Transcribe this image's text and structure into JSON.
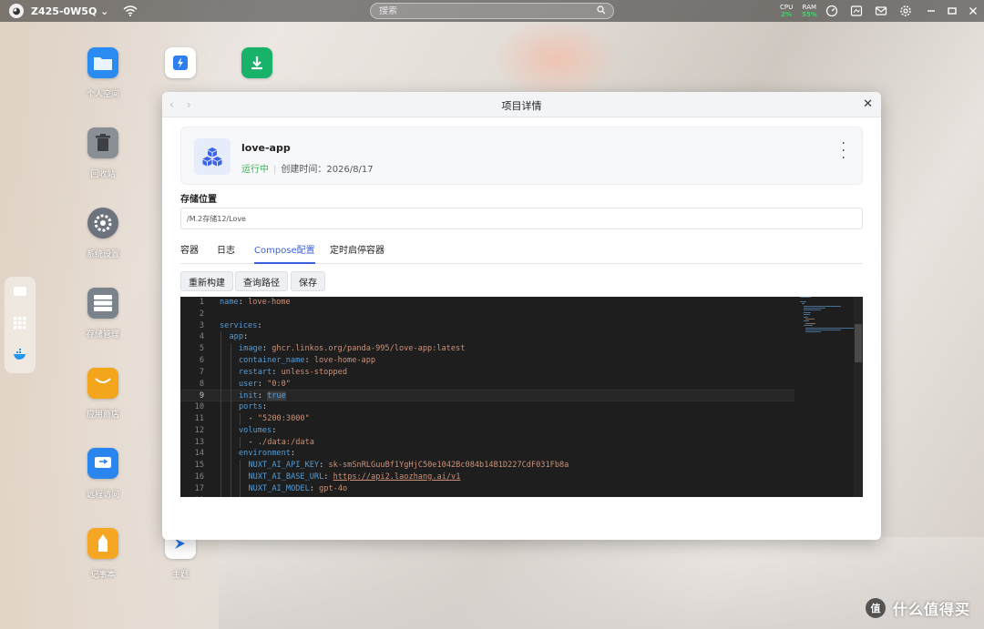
{
  "topbar": {
    "device_name": "Z425-0W5Q",
    "search_placeholder": "搜索",
    "cpu_label": "CPU",
    "cpu_value": "2%",
    "ram_label": "RAM",
    "ram_value": "55%"
  },
  "desktop_icons": [
    {
      "label": "个人空间",
      "icon": "folder-icon",
      "color": "#2a8bf2"
    },
    {
      "label": "回收站",
      "icon": "trash-icon",
      "color": "#8a8f96"
    },
    {
      "label": "系统设置",
      "icon": "gear-icon",
      "color": "#6c737c"
    },
    {
      "label": "存储管理",
      "icon": "storage-icon",
      "color": "#7a828c"
    },
    {
      "label": "应用商店",
      "icon": "store-icon",
      "color": "#f3a51c"
    },
    {
      "label": "远程访问",
      "icon": "remote-icon",
      "color": "#2a86ee"
    },
    {
      "label": "记事本",
      "icon": "notepad-icon",
      "color": "#f5a623"
    },
    {
      "label": "主题",
      "icon": "theme-icon",
      "color": "#1e73e8"
    }
  ],
  "window": {
    "title": "项目详情",
    "project": {
      "name": "love-app",
      "status": "运行中",
      "created_label": "创建时间：",
      "created_date": "2026/8/17"
    },
    "storage": {
      "label": "存储位置",
      "path": "/M.2存储12/Love"
    },
    "tabs": [
      {
        "label": "容器",
        "active": false
      },
      {
        "label": "日志",
        "active": false
      },
      {
        "label": "Compose配置",
        "active": true
      },
      {
        "label": "定时启停容器",
        "active": false
      }
    ],
    "buttons": {
      "rebuild": "重新构建",
      "query_path": "查询路径",
      "save": "保存"
    },
    "editor": {
      "current_line": 9,
      "lines": [
        {
          "n": "1",
          "indent": 0,
          "key": "name",
          "val": "love-home"
        },
        {
          "n": "2",
          "indent": 0
        },
        {
          "n": "3",
          "indent": 0,
          "key": "services"
        },
        {
          "n": "4",
          "indent": 1,
          "key": "app"
        },
        {
          "n": "5",
          "indent": 2,
          "key": "image",
          "val": "ghcr.linkos.org/panda-995/love-app:latest"
        },
        {
          "n": "6",
          "indent": 2,
          "key": "container_name",
          "val": "love-home-app"
        },
        {
          "n": "7",
          "indent": 2,
          "key": "restart",
          "val": "unless-stopped"
        },
        {
          "n": "8",
          "indent": 2,
          "key": "user",
          "val": "\"0:0\""
        },
        {
          "n": "9",
          "indent": 2,
          "key": "init",
          "val": "true"
        },
        {
          "n": "10",
          "indent": 2,
          "key": "ports"
        },
        {
          "n": "11",
          "indent": 3,
          "item": "\"5200:3000\""
        },
        {
          "n": "12",
          "indent": 2,
          "key": "volumes"
        },
        {
          "n": "13",
          "indent": 3,
          "item": "./data:/data"
        },
        {
          "n": "14",
          "indent": 2,
          "key": "environment"
        },
        {
          "n": "15",
          "indent": 3,
          "key": "NUXT_AI_API_KEY",
          "val": "sk-smSnRLGuuBf1YgHjC50e1042Bc084b14B1D227CdF031Fb8a"
        },
        {
          "n": "16",
          "indent": 3,
          "key": "NUXT_AI_BASE_URL",
          "val": "https://api2.laozhang.ai/v1"
        },
        {
          "n": "17",
          "indent": 3,
          "key": "NUXT_AI_MODEL",
          "val": "gpt-4o"
        },
        {
          "n": "18",
          "indent": 3
        }
      ]
    }
  },
  "watermark": {
    "badge": "值",
    "text": "什么值得买"
  }
}
